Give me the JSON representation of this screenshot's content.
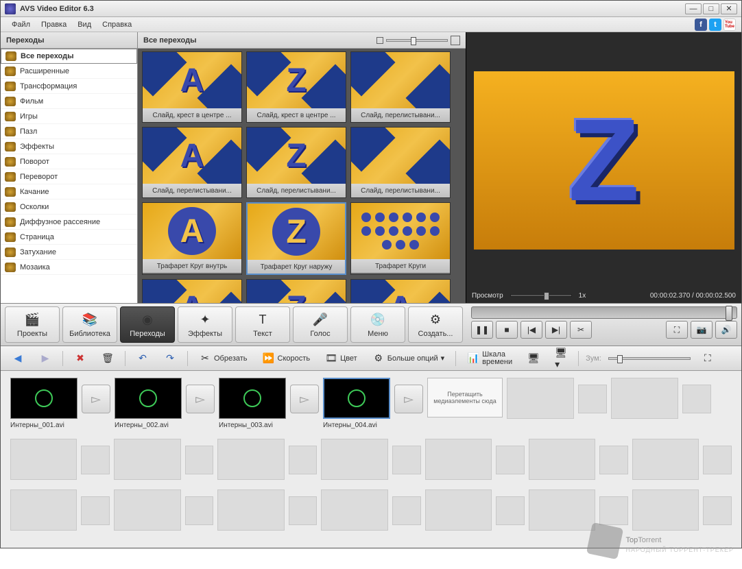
{
  "app": {
    "title": "AVS Video Editor 6.3"
  },
  "menu": {
    "items": [
      "Файл",
      "Правка",
      "Вид",
      "Справка"
    ]
  },
  "social": {
    "fb": "f",
    "tw": "t",
    "yt": "YouTube"
  },
  "sidebar": {
    "header": "Переходы",
    "items": [
      "Все переходы",
      "Расширенные",
      "Трансформация",
      "Фильм",
      "Игры",
      "Пазл",
      "Эффекты",
      "Поворот",
      "Переворот",
      "Качание",
      "Осколки",
      "Диффузное рассеяние",
      "Страница",
      "Затухание",
      "Мозаика"
    ],
    "selected": 0
  },
  "gallery": {
    "header": "Все переходы",
    "items": [
      {
        "label": "Слайд, крест в центре ...",
        "letter": "A",
        "style": "wedge"
      },
      {
        "label": "Слайд, крест в центре ...",
        "letter": "Z",
        "style": "wedge"
      },
      {
        "label": "Слайд, перелистывани...",
        "letter": "",
        "style": "wedge"
      },
      {
        "label": "Слайд, перелистывани...",
        "letter": "A",
        "style": "wedge"
      },
      {
        "label": "Слайд, перелистывани...",
        "letter": "Z",
        "style": "wedge"
      },
      {
        "label": "Слайд, перелистывани...",
        "letter": "",
        "style": "wedge"
      },
      {
        "label": "Трафарет Круг внутрь",
        "letter": "A",
        "style": "circle"
      },
      {
        "label": "Трафарет Круг наружу",
        "letter": "Z",
        "style": "circle",
        "selected": true
      },
      {
        "label": "Трафарет Круги",
        "letter": "",
        "style": "dots"
      },
      {
        "label": "",
        "letter": "A",
        "style": "wedge"
      },
      {
        "label": "",
        "letter": "Z",
        "style": "wedge"
      },
      {
        "label": "",
        "letter": "A",
        "style": "wedge"
      }
    ]
  },
  "preview": {
    "label": "Просмотр",
    "speed": "1x",
    "time_current": "00:00:02.370",
    "time_total": "00:00:02.500",
    "time_sep": " / "
  },
  "maintabs": {
    "items": [
      "Проекты",
      "Библиотека",
      "Переходы",
      "Эффекты",
      "Текст",
      "Голос",
      "Меню",
      "Создать..."
    ],
    "active": 2,
    "icons": [
      "🎬",
      "📚",
      "◉",
      "✦",
      "T",
      "🎤",
      "💿",
      "⚙"
    ]
  },
  "timeline_toolbar": {
    "undo": "↶",
    "redo": "↷",
    "del": "✖",
    "crop_icon": "✂",
    "crop": "Обрезать",
    "speed_icon": "⏩",
    "speed": "Скорость",
    "color_icon": "🎞",
    "color": "Цвет",
    "more_icon": "⚙",
    "more": "Больше опций",
    "more_dd": "▾",
    "scale_icon": "📊",
    "scale_l1": "Шкала",
    "scale_l2": "времени",
    "zoom_label": "Зум:"
  },
  "storyboard": {
    "clips": [
      "Интерны_001.avi",
      "Интерны_002.avi",
      "Интерны_003.avi",
      "Интерны_004.avi"
    ],
    "dropzone": "Перетащить медиаэлементы сюда",
    "arrow": "▻"
  },
  "watermark": {
    "brand1": "Top",
    "brand2": "Torrent",
    "sub": "НАРОДНЫЙ ТОРРЕНТ-ТРЕКЕР"
  }
}
